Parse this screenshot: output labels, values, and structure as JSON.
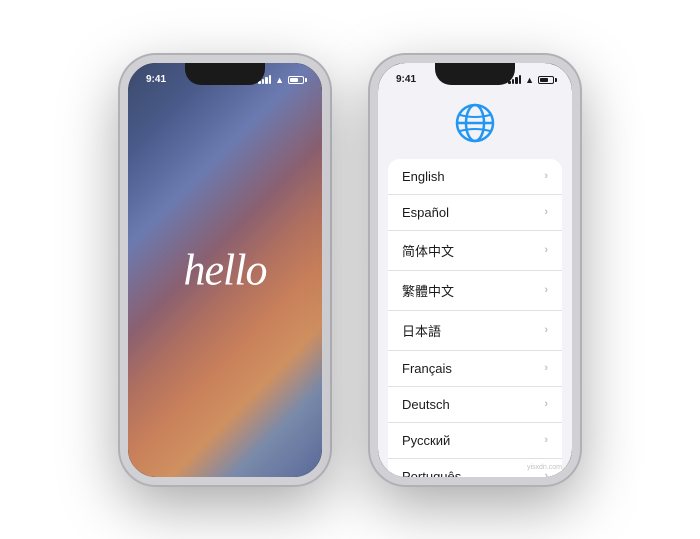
{
  "phone1": {
    "hello_text": "hello",
    "status": {
      "time": "9:41",
      "theme": "light"
    }
  },
  "phone2": {
    "globe_icon": "globe-icon",
    "status": {
      "time": "9:41",
      "theme": "dark"
    },
    "languages": [
      {
        "name": "English",
        "id": "english"
      },
      {
        "name": "Español",
        "id": "espanol"
      },
      {
        "name": "简体中文",
        "id": "simplified-chinese"
      },
      {
        "name": "繁體中文",
        "id": "traditional-chinese"
      },
      {
        "name": "日本語",
        "id": "japanese"
      },
      {
        "name": "Français",
        "id": "french"
      },
      {
        "name": "Deutsch",
        "id": "german"
      },
      {
        "name": "Русский",
        "id": "russian"
      },
      {
        "name": "Português",
        "id": "portuguese"
      }
    ]
  },
  "watermark": "yisxdn.com"
}
